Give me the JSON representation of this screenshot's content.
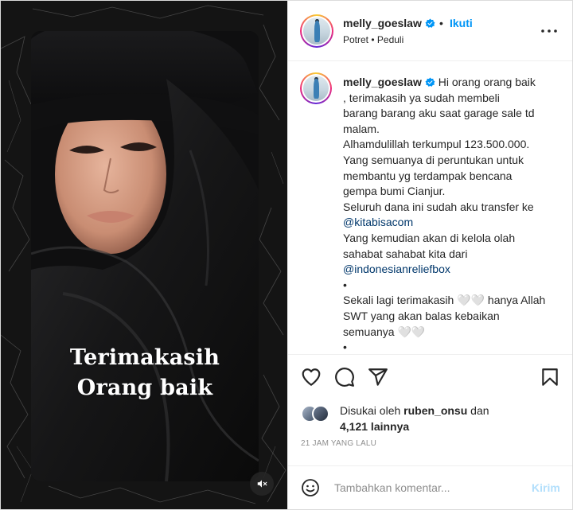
{
  "media": {
    "overlay_line1": "Terimakasih",
    "overlay_line2": "Orang baik",
    "mute_icon": "speaker-muted-icon"
  },
  "header": {
    "username": "melly_goeslaw",
    "verified": true,
    "separator": "•",
    "follow_label": "Ikuti",
    "subtitle": "Potret • Peduli",
    "more_icon": "more-horizontal-icon"
  },
  "caption": {
    "username": "melly_goeslaw",
    "first_line": "Hi orang orang baik",
    "lines": [
      ", terimakasih ya sudah membeli",
      "barang barang aku saat garage sale td",
      "malam.",
      "Alhamdulillah terkumpul 123.500.000.",
      "Yang semuanya di peruntukan untuk",
      "membantu yg terdampak bencana",
      "gempa bumi Cianjur.",
      "Seluruh dana ini sudah aku transfer ke"
    ],
    "mention1": "@kitabisacom",
    "lines2": [
      "Yang kemudian akan di kelola olah",
      "sahabat sahabat kita dari"
    ],
    "mention2": "@indonesianreliefbox",
    "bullet": "•",
    "lines3": [
      "Sekali lagi terimakasih 🤍🤍 hanya Allah",
      "SWT yang akan balas kebaikan",
      "semuanya 🤍🤍"
    ],
    "bullet2": "•"
  },
  "actions": {
    "like_icon": "heart-icon",
    "comment_icon": "comment-icon",
    "share_icon": "share-icon",
    "save_icon": "bookmark-icon"
  },
  "likes": {
    "prefix": "Disukai oleh",
    "user": "ruben_onsu",
    "conjunction": "dan",
    "count": "4,121 lainnya"
  },
  "timestamp": "21 JAM YANG LALU",
  "comment": {
    "placeholder": "Tambahkan komentar...",
    "post_label": "Kirim",
    "emoji_icon": "emoji-smile-icon"
  },
  "colors": {
    "accent": "#0095f6",
    "link": "#00376b",
    "muted": "#8e8e8e",
    "post_disabled": "#b2dffc"
  }
}
